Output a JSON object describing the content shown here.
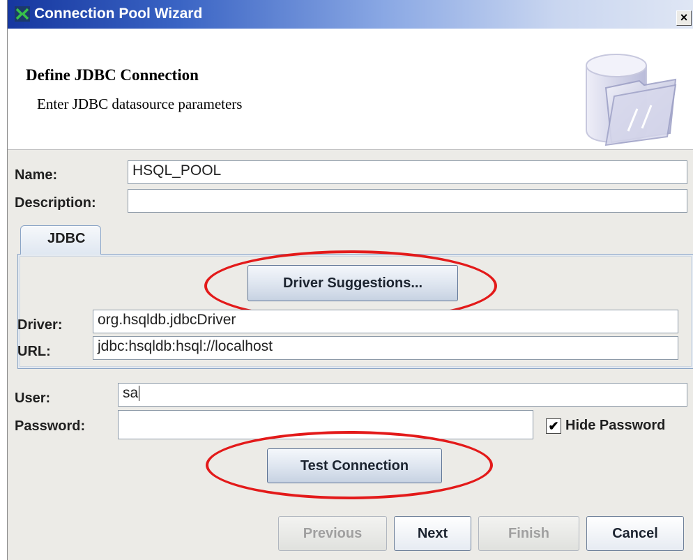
{
  "window": {
    "title": "Connection Pool Wizard",
    "close_glyph": "×"
  },
  "header": {
    "title": "Define JDBC Connection",
    "subtitle": "Enter JDBC datasource parameters",
    "icon": "database-folder-icon"
  },
  "form": {
    "name_label": "Name:",
    "name_value": "HSQL_POOL",
    "description_label": "Description:",
    "description_value": "",
    "user_label": "User:",
    "user_value": "sa",
    "password_label": "Password:",
    "password_value": "",
    "hide_password_label": "Hide Password",
    "hide_password_checked": true,
    "check_glyph": "✔"
  },
  "tabs": [
    {
      "label": "JDBC",
      "selected": true
    }
  ],
  "jdbc": {
    "driver_suggestions_label": "Driver Suggestions...",
    "driver_label": "Driver:",
    "driver_value": "org.hsqldb.jdbcDriver",
    "url_label": "URL:",
    "url_value": "jdbc:hsqldb:hsql://localhost"
  },
  "actions": {
    "test_connection_label": "Test Connection",
    "previous_label": "Previous",
    "next_label": "Next",
    "finish_label": "Finish",
    "cancel_label": "Cancel"
  },
  "colors": {
    "title_gradient_start": "#16379f",
    "annotation_red": "#e31a1a",
    "window_bg": "#ecebe7"
  }
}
